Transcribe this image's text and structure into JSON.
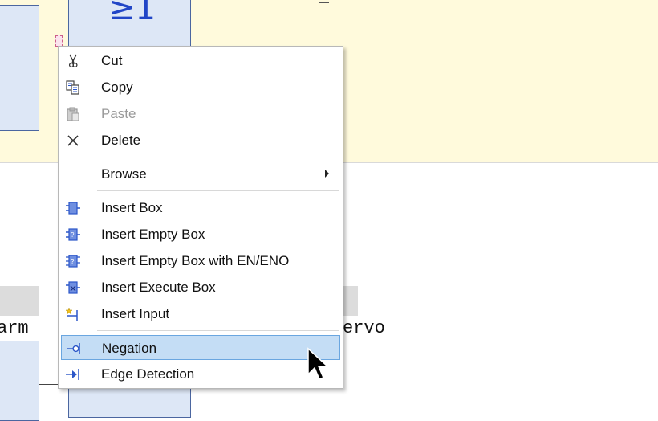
{
  "diagram": {
    "operator_symbol": "≥1",
    "left_variable": "arm",
    "right_variable": "ervo"
  },
  "context_menu": {
    "items": [
      {
        "label": "Cut",
        "icon": "scissors-icon",
        "enabled": true
      },
      {
        "label": "Copy",
        "icon": "copy-icon",
        "enabled": true
      },
      {
        "label": "Paste",
        "icon": "paste-icon",
        "enabled": false
      },
      {
        "label": "Delete",
        "icon": "delete-x-icon",
        "enabled": true
      },
      {
        "label": "Browse",
        "icon": null,
        "enabled": true,
        "submenu": true
      },
      {
        "label": "Insert Box",
        "icon": "insert-box-icon",
        "enabled": true
      },
      {
        "label": "Insert Empty Box",
        "icon": "insert-empty-box-icon",
        "enabled": true
      },
      {
        "label": "Insert Empty Box with EN/ENO",
        "icon": "insert-empty-box-en-eno-icon",
        "enabled": true
      },
      {
        "label": "Insert Execute Box",
        "icon": "insert-execute-box-icon",
        "enabled": true
      },
      {
        "label": "Insert Input",
        "icon": "insert-input-icon",
        "enabled": true
      },
      {
        "label": "Negation",
        "icon": "negation-icon",
        "enabled": true,
        "highlighted": true
      },
      {
        "label": "Edge Detection",
        "icon": "edge-detection-icon",
        "enabled": true
      }
    ]
  },
  "colors": {
    "editor_background": "#fffadc",
    "box_fill": "#dde7f6",
    "highlight": "#c4ddf5",
    "icon_blue": "#2b56c8"
  }
}
